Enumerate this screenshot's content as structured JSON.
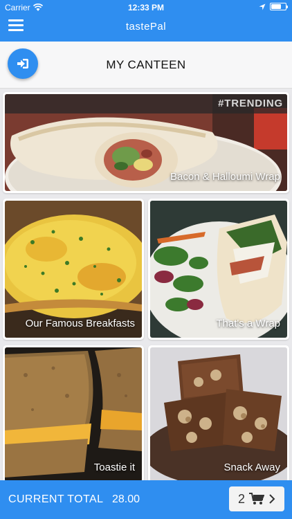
{
  "status": {
    "carrier": "Carrier",
    "time": "12:33 PM"
  },
  "navbar": {
    "title": "tastePal"
  },
  "header": {
    "title": "MY CANTEEN"
  },
  "featured": {
    "tag": "#TRENDING",
    "label": "Bacon & Halloumi Wrap"
  },
  "tiles": [
    {
      "label": "Our Famous Breakfasts"
    },
    {
      "label": "That's a Wrap"
    },
    {
      "label": "Toastie it"
    },
    {
      "label": "Snack Away"
    }
  ],
  "footer": {
    "total_label": "CURRENT TOTAL",
    "total_value": "28.00",
    "cart_count": "2"
  },
  "colors": {
    "primary": "#2f8ef0"
  },
  "icons": [
    "wifi-icon",
    "location-icon",
    "battery-icon",
    "menu-icon",
    "sign-in-icon",
    "cart-icon",
    "chevron-right-icon"
  ]
}
